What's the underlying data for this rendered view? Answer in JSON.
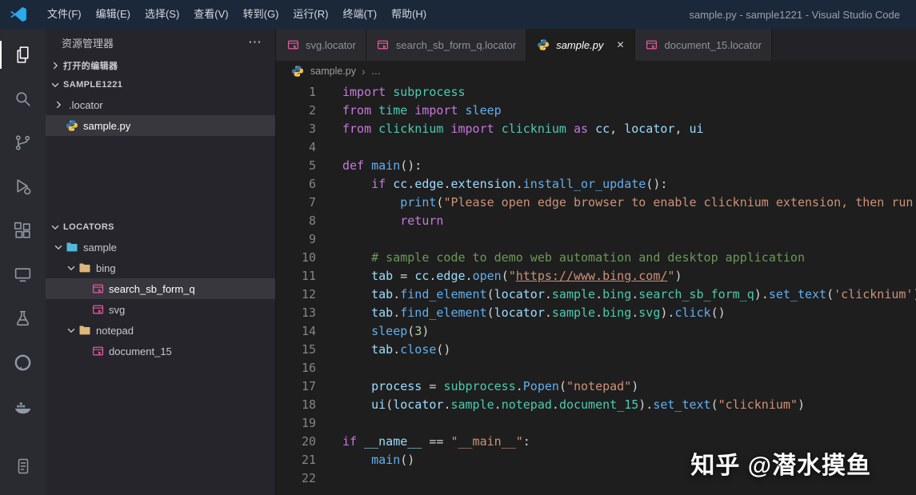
{
  "window_title": "sample.py - sample1221 - Visual Studio Code",
  "menu_bar": [
    "文件(F)",
    "编辑(E)",
    "选择(S)",
    "查看(V)",
    "转到(G)",
    "运行(R)",
    "终端(T)",
    "帮助(H)"
  ],
  "glyphs": {
    "close": "✕",
    "more": "⋯",
    "breadcrumb_sep": "›",
    "breadcrumb_more": "…"
  },
  "colors": {
    "logo_blue": "#29a9f0",
    "locator_pink": "#e0559e",
    "folder_yellow": "#dcb67a",
    "folder_cyan": "#52b7d6",
    "python_blue": "#3b77a8",
    "python_yellow": "#f0c24b",
    "syntax": {
      "keyword": "#c678dd",
      "function": "#61afef",
      "module": "#4ec9b0",
      "variable": "#9cdcfe",
      "string": "#ce9178",
      "comment": "#6a9955",
      "number": "#b5cea8",
      "punctuation": "#d4d4d4"
    }
  },
  "activity_bar": [
    {
      "id": "explorer",
      "icon": "files",
      "active": true
    },
    {
      "id": "search",
      "icon": "search",
      "active": false
    },
    {
      "id": "source-control",
      "icon": "scm",
      "active": false
    },
    {
      "id": "run-debug",
      "icon": "debug",
      "active": false
    },
    {
      "id": "extensions",
      "icon": "extensions",
      "active": false
    },
    {
      "id": "remote-explorer",
      "icon": "remote",
      "active": false
    },
    {
      "id": "testing",
      "icon": "beaker",
      "active": false
    },
    {
      "id": "github",
      "icon": "github",
      "active": false
    },
    {
      "id": "docker",
      "icon": "docker",
      "active": false
    }
  ],
  "activity_bar_bottom": [
    {
      "id": "output",
      "icon": "doc",
      "active": false
    }
  ],
  "sidebar": {
    "title": "资源管理器",
    "sections": [
      {
        "label": "打开的编辑器",
        "expanded": false,
        "items": []
      },
      {
        "label": "SAMPLE1221",
        "expanded": true,
        "items": [
          {
            "label": ".locator",
            "indent": 1,
            "chevron": "collapsed",
            "icon": null,
            "selected": false
          },
          {
            "label": "sample.py",
            "indent": 1,
            "chevron": null,
            "icon": "python",
            "selected": true
          }
        ]
      },
      {
        "label": "LOCATORS",
        "expanded": true,
        "items": [
          {
            "label": "sample",
            "indent": 1,
            "chevron": "expanded",
            "icon": "folder-cyan",
            "selected": false
          },
          {
            "label": "bing",
            "indent": 2,
            "chevron": "expanded",
            "icon": "folder",
            "selected": false
          },
          {
            "label": "search_sb_form_q",
            "indent": 3,
            "chevron": null,
            "icon": "locator",
            "selected": true
          },
          {
            "label": "svg",
            "indent": 3,
            "chevron": null,
            "icon": "locator",
            "selected": false
          },
          {
            "label": "notepad",
            "indent": 2,
            "chevron": "expanded",
            "icon": "folder",
            "selected": false
          },
          {
            "label": "document_15",
            "indent": 3,
            "chevron": null,
            "icon": "locator",
            "selected": false
          }
        ]
      }
    ]
  },
  "tabs": [
    {
      "label": "svg.locator",
      "icon": "locator",
      "active": false,
      "italic": false,
      "close": false
    },
    {
      "label": "search_sb_form_q.locator",
      "icon": "locator",
      "active": false,
      "italic": false,
      "close": false
    },
    {
      "label": "sample.py",
      "icon": "python",
      "active": true,
      "italic": true,
      "close": true
    },
    {
      "label": "document_15.locator",
      "icon": "locator",
      "active": false,
      "italic": false,
      "close": false
    }
  ],
  "breadcrumb": {
    "file": "sample.py"
  },
  "code_lines": [
    [
      [
        "k",
        "import"
      ],
      [
        "p",
        " "
      ],
      [
        "m",
        "subprocess"
      ]
    ],
    [
      [
        "k",
        "from"
      ],
      [
        "p",
        " "
      ],
      [
        "m",
        "time"
      ],
      [
        "p",
        " "
      ],
      [
        "k",
        "import"
      ],
      [
        "p",
        " "
      ],
      [
        "f",
        "sleep"
      ]
    ],
    [
      [
        "k",
        "from"
      ],
      [
        "p",
        " "
      ],
      [
        "m",
        "clicknium"
      ],
      [
        "p",
        " "
      ],
      [
        "k",
        "import"
      ],
      [
        "p",
        " "
      ],
      [
        "m",
        "clicknium"
      ],
      [
        "p",
        " "
      ],
      [
        "k",
        "as"
      ],
      [
        "p",
        " "
      ],
      [
        "v",
        "cc"
      ],
      [
        "p",
        ", "
      ],
      [
        "v",
        "locator"
      ],
      [
        "p",
        ", "
      ],
      [
        "v",
        "ui"
      ]
    ],
    [],
    [
      [
        "k",
        "def"
      ],
      [
        "p",
        " "
      ],
      [
        "f",
        "main"
      ],
      [
        "p",
        "():"
      ]
    ],
    [
      [
        "p",
        "    "
      ],
      [
        "k",
        "if"
      ],
      [
        "p",
        " "
      ],
      [
        "v",
        "cc"
      ],
      [
        "p",
        "."
      ],
      [
        "v",
        "edge"
      ],
      [
        "p",
        "."
      ],
      [
        "v",
        "extension"
      ],
      [
        "p",
        "."
      ],
      [
        "f",
        "install_or_update"
      ],
      [
        "p",
        "():"
      ]
    ],
    [
      [
        "p",
        "        "
      ],
      [
        "f",
        "print"
      ],
      [
        "p",
        "("
      ],
      [
        "s",
        "\"Please open edge browser to enable clicknium extension, then run the sample again.\""
      ],
      [
        "p",
        ")"
      ]
    ],
    [
      [
        "p",
        "        "
      ],
      [
        "k",
        "return"
      ]
    ],
    [],
    [
      [
        "p",
        "    "
      ],
      [
        "c",
        "# sample code to demo web automation and desktop application"
      ]
    ],
    [
      [
        "p",
        "    "
      ],
      [
        "v",
        "tab"
      ],
      [
        "p",
        " = "
      ],
      [
        "v",
        "cc"
      ],
      [
        "p",
        "."
      ],
      [
        "v",
        "edge"
      ],
      [
        "p",
        "."
      ],
      [
        "f",
        "open"
      ],
      [
        "p",
        "("
      ],
      [
        "s",
        "\""
      ],
      [
        "u",
        "https://www.bing.com/"
      ],
      [
        "s",
        "\""
      ],
      [
        "p",
        ")"
      ]
    ],
    [
      [
        "p",
        "    "
      ],
      [
        "v",
        "tab"
      ],
      [
        "p",
        "."
      ],
      [
        "f",
        "find_element"
      ],
      [
        "p",
        "("
      ],
      [
        "v",
        "locator"
      ],
      [
        "p",
        "."
      ],
      [
        "m",
        "sample"
      ],
      [
        "p",
        "."
      ],
      [
        "m",
        "bing"
      ],
      [
        "p",
        "."
      ],
      [
        "m",
        "search_sb_form_q"
      ],
      [
        "p",
        ")."
      ],
      [
        "f",
        "set_text"
      ],
      [
        "p",
        "("
      ],
      [
        "s",
        "'clicknium'"
      ],
      [
        "p",
        ")"
      ]
    ],
    [
      [
        "p",
        "    "
      ],
      [
        "v",
        "tab"
      ],
      [
        "p",
        "."
      ],
      [
        "f",
        "find_element"
      ],
      [
        "p",
        "("
      ],
      [
        "v",
        "locator"
      ],
      [
        "p",
        "."
      ],
      [
        "m",
        "sample"
      ],
      [
        "p",
        "."
      ],
      [
        "m",
        "bing"
      ],
      [
        "p",
        "."
      ],
      [
        "m",
        "svg"
      ],
      [
        "p",
        ")."
      ],
      [
        "f",
        "click"
      ],
      [
        "p",
        "()"
      ]
    ],
    [
      [
        "p",
        "    "
      ],
      [
        "f",
        "sleep"
      ],
      [
        "p",
        "("
      ],
      [
        "n",
        "3"
      ],
      [
        "p",
        ")"
      ]
    ],
    [
      [
        "p",
        "    "
      ],
      [
        "v",
        "tab"
      ],
      [
        "p",
        "."
      ],
      [
        "f",
        "close"
      ],
      [
        "p",
        "()"
      ]
    ],
    [],
    [
      [
        "p",
        "    "
      ],
      [
        "v",
        "process"
      ],
      [
        "p",
        " = "
      ],
      [
        "m",
        "subprocess"
      ],
      [
        "p",
        "."
      ],
      [
        "f",
        "Popen"
      ],
      [
        "p",
        "("
      ],
      [
        "s",
        "\"notepad\""
      ],
      [
        "p",
        ")"
      ]
    ],
    [
      [
        "p",
        "    "
      ],
      [
        "v",
        "ui"
      ],
      [
        "p",
        "("
      ],
      [
        "v",
        "locator"
      ],
      [
        "p",
        "."
      ],
      [
        "m",
        "sample"
      ],
      [
        "p",
        "."
      ],
      [
        "m",
        "notepad"
      ],
      [
        "p",
        "."
      ],
      [
        "m",
        "document_15"
      ],
      [
        "p",
        ")."
      ],
      [
        "f",
        "set_text"
      ],
      [
        "p",
        "("
      ],
      [
        "s",
        "\"clicknium\""
      ],
      [
        "p",
        ")"
      ]
    ],
    [],
    [
      [
        "k",
        "if"
      ],
      [
        "p",
        " "
      ],
      [
        "v",
        "__name__"
      ],
      [
        "p",
        " == "
      ],
      [
        "s",
        "\"__main__\""
      ],
      [
        "p",
        ":"
      ]
    ],
    [
      [
        "p",
        "    "
      ],
      [
        "f",
        "main"
      ],
      [
        "p",
        "()"
      ]
    ],
    []
  ],
  "watermark": "知乎 @潜水摸鱼"
}
